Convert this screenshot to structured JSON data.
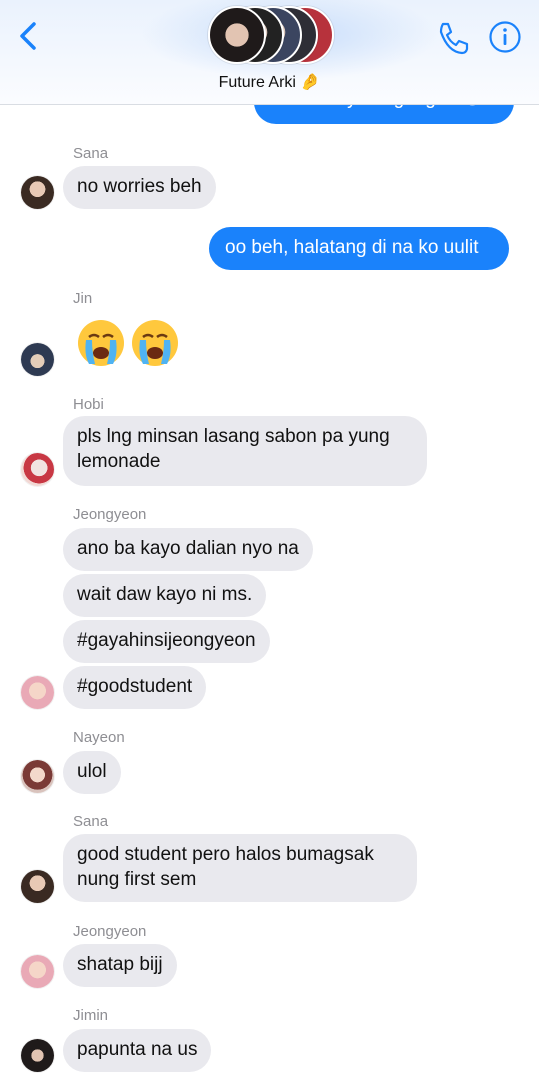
{
  "header": {
    "group_name": "Future Arki 🤌",
    "back_icon": "chevron-left-icon",
    "call_icon": "phone-icon",
    "info_icon": "info-icon",
    "accent": "#1a82fb"
  },
  "messages": {
    "m0": {
      "text": "dito ata sya naghugas 😭"
    },
    "sana1": {
      "sender": "Sana",
      "text": "no worries beh"
    },
    "m2": {
      "text": "oo beh, halatang di na ko uulit"
    },
    "jin": {
      "sender": "Jin",
      "emoji": "😭😭"
    },
    "hobi": {
      "sender": "Hobi",
      "text": "pls lng minsan lasang sabon pa yung lemonade"
    },
    "jeong1": {
      "sender": "Jeongyeon",
      "b1": "ano ba kayo dalian nyo na",
      "b2": "wait daw kayo ni ms.",
      "b3": "#gayahinsijeongyeon",
      "b4": "#goodstudent"
    },
    "nayeon": {
      "sender": "Nayeon",
      "text": "ulol"
    },
    "sana2": {
      "sender": "Sana",
      "text": "good student pero halos bumagsak nung first sem"
    },
    "jeong2": {
      "sender": "Jeongyeon",
      "text": "shatap bijj"
    },
    "jimin": {
      "sender": "Jimin",
      "text": "papunta na us"
    }
  },
  "colors": {
    "outgoing_bubble": "#1a82fb",
    "incoming_bubble": "#e9e9ee",
    "sender_label": "#8e8e93"
  }
}
